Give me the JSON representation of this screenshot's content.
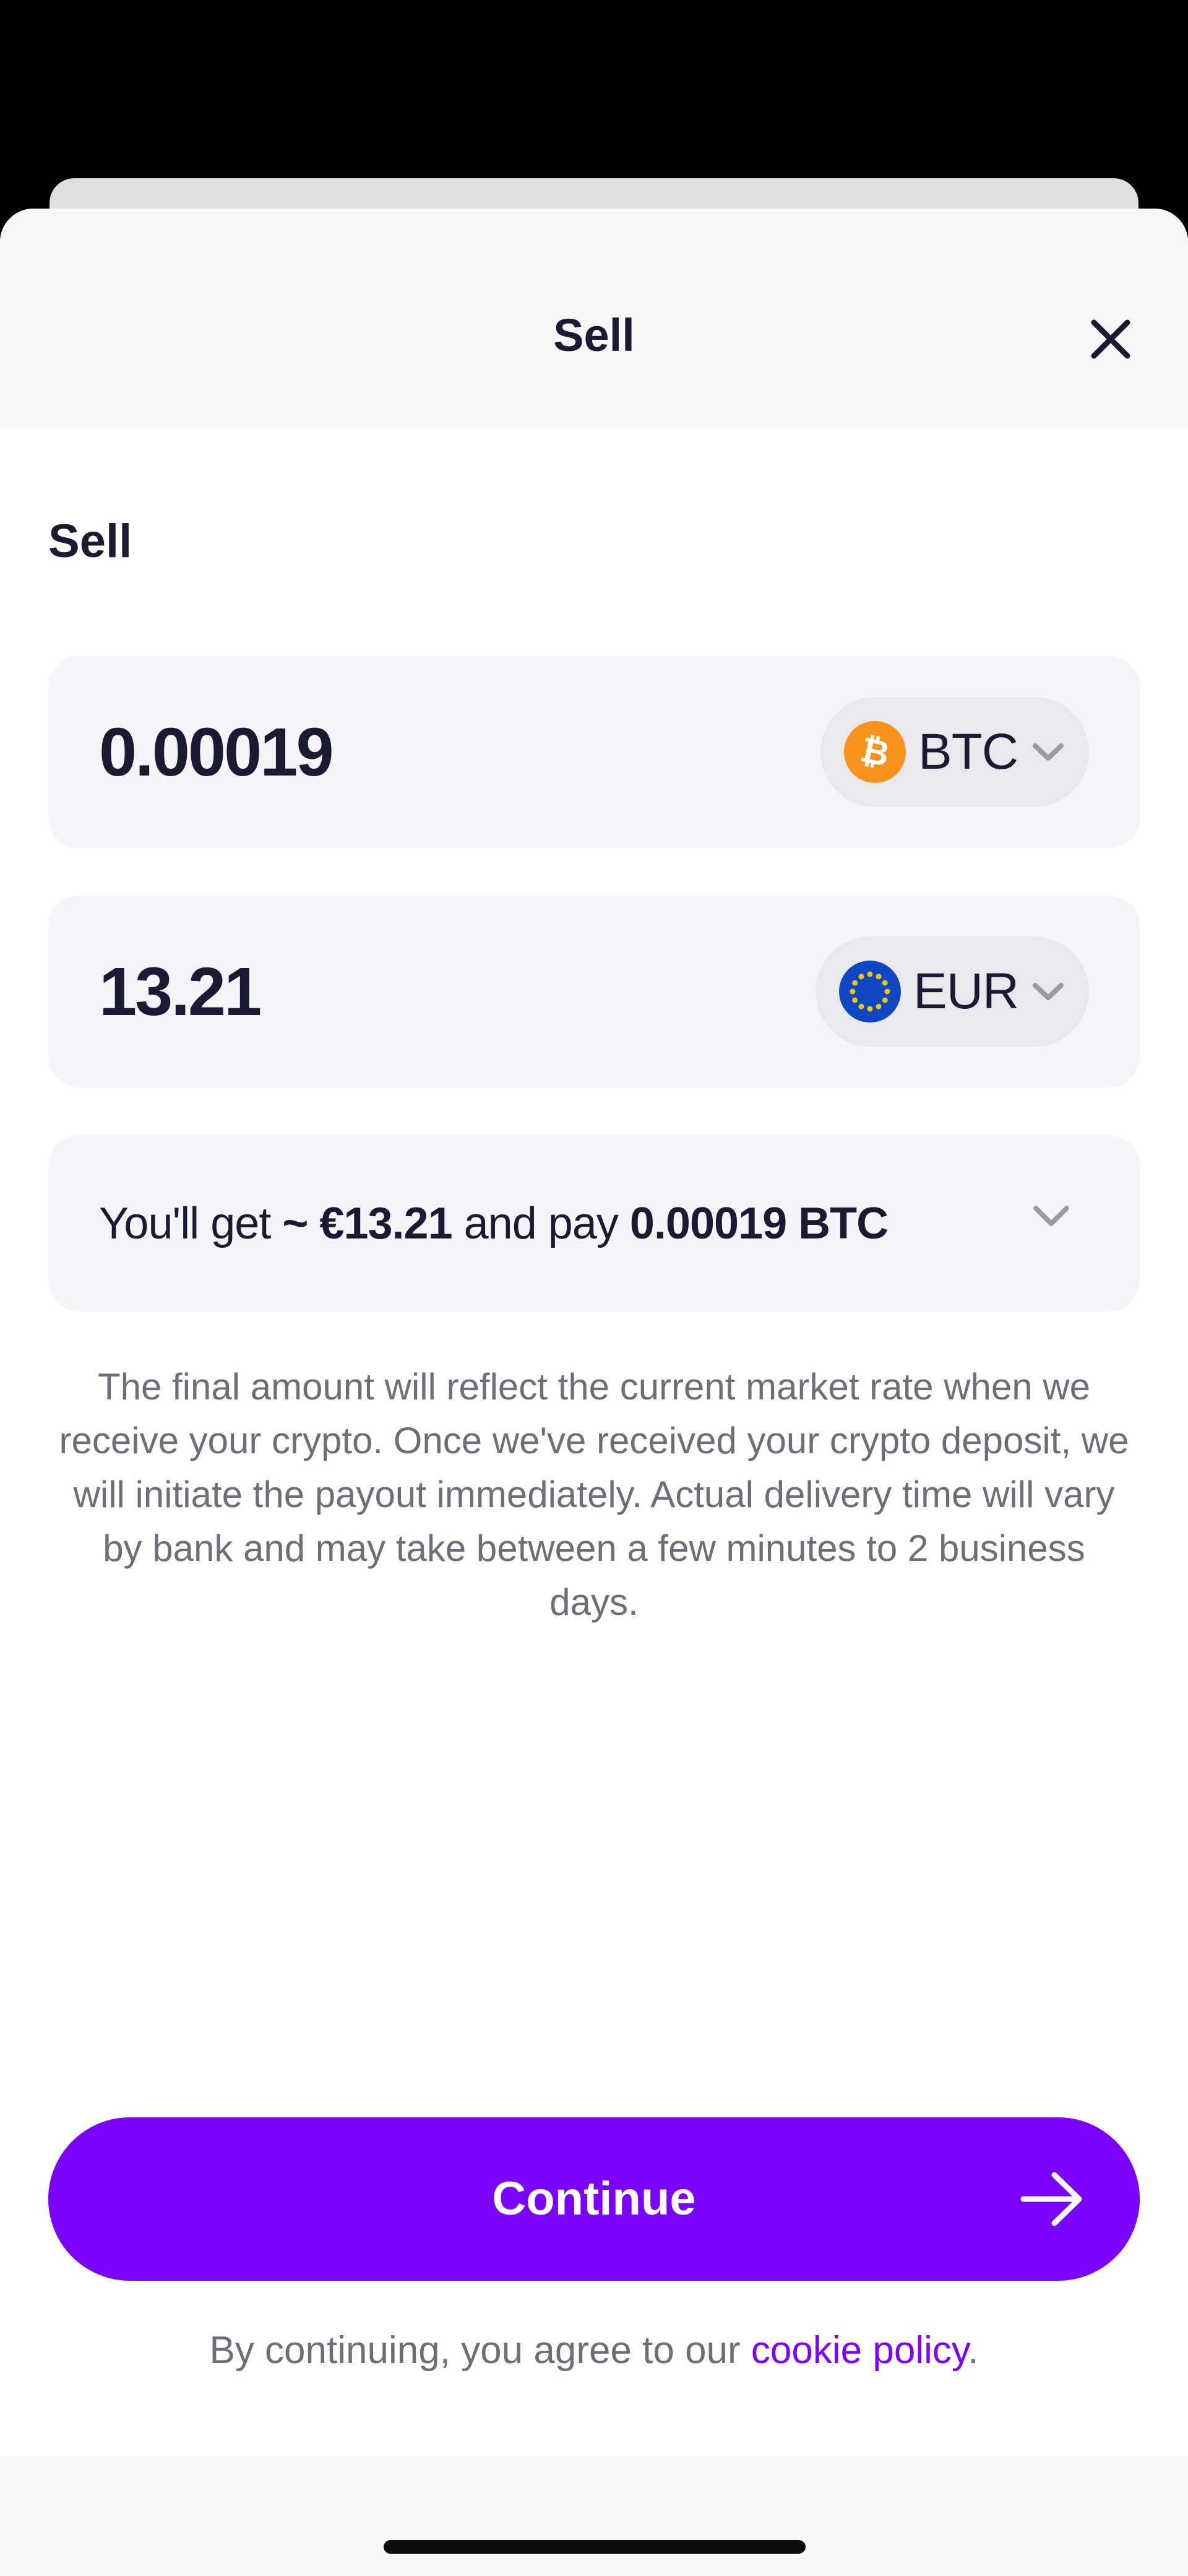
{
  "sheet": {
    "title": "Sell",
    "close_icon": "close-icon"
  },
  "form": {
    "section_label": "Sell",
    "crypto": {
      "amount": "0.00019",
      "currency": "BTC",
      "icon": "bitcoin-icon",
      "icon_color": "#f7931a"
    },
    "fiat": {
      "amount": "13.21",
      "currency": "EUR",
      "icon": "eu-flag-icon",
      "icon_color": "#0e47c1"
    }
  },
  "summary": {
    "prefix": "You'll get ",
    "receive": "~ €13.21",
    "middle": " and pay ",
    "pay": "0.00019 BTC"
  },
  "disclaimer": "The final amount will reflect the current market rate when we receive your crypto. Once we've received your crypto deposit, we will initiate the payout immediately. Actual delivery time will vary by bank and may take between a few minutes to 2 business days.",
  "actions": {
    "continue_label": "Continue",
    "continue_icon": "arrow-right-icon"
  },
  "legal": {
    "prefix": "By continuing, you agree to our ",
    "link_text": "cookie policy",
    "suffix": "."
  },
  "colors": {
    "accent": "#7a00ff",
    "text_primary": "#1c1a33",
    "text_secondary": "#6e6e78",
    "field_background": "#f5f5f7"
  }
}
